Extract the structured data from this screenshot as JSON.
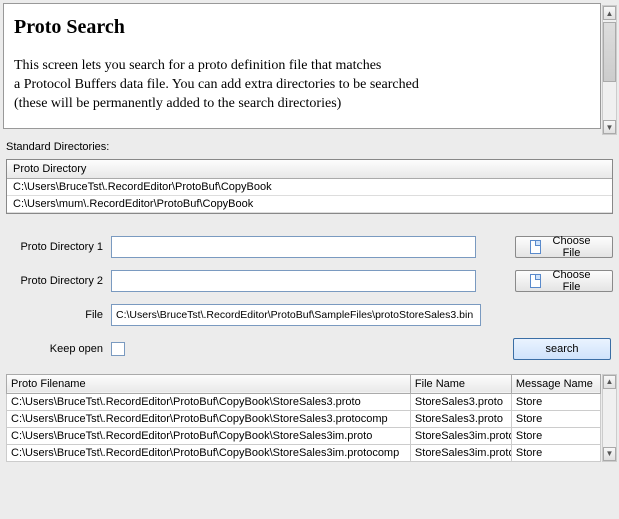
{
  "header": {
    "title": "Proto Search",
    "desc_line1": "This screen lets you search for a proto definition file that matches",
    "desc_line2": "a Protocol Buffers data file. You can add extra directories to be searched",
    "desc_line3": "(these will be permanently added to the search directories)"
  },
  "std_dirs": {
    "label": "Standard Directories:",
    "header": "Proto Directory",
    "rows": [
      "C:\\Users\\BruceTst\\.RecordEditor\\ProtoBuf\\CopyBook",
      "C:\\Users\\mum\\.RecordEditor\\ProtoBuf\\CopyBook"
    ]
  },
  "form": {
    "dir1_label": "Proto Directory 1",
    "dir1_value": "",
    "dir2_label": "Proto Directory 2",
    "dir2_value": "",
    "file_label": "File",
    "file_value": "C:\\Users\\BruceTst\\.RecordEditor\\ProtoBuf\\SampleFiles\\protoStoreSales3.bin",
    "choose_label": "Choose File",
    "keep_label": "Keep open",
    "search_label": "search"
  },
  "results": {
    "col1": "Proto Filename",
    "col2": "File Name",
    "col3": "Message Name",
    "rows": [
      {
        "filename": "C:\\Users\\BruceTst\\.RecordEditor\\ProtoBuf\\CopyBook\\StoreSales3.proto",
        "file": "StoreSales3.proto",
        "msg": "Store"
      },
      {
        "filename": "C:\\Users\\BruceTst\\.RecordEditor\\ProtoBuf\\CopyBook\\StoreSales3.protocomp",
        "file": "StoreSales3.proto",
        "msg": "Store"
      },
      {
        "filename": "C:\\Users\\BruceTst\\.RecordEditor\\ProtoBuf\\CopyBook\\StoreSales3im.proto",
        "file": "StoreSales3im.proto",
        "msg": "Store"
      },
      {
        "filename": "C:\\Users\\BruceTst\\.RecordEditor\\ProtoBuf\\CopyBook\\StoreSales3im.protocomp",
        "file": "StoreSales3im.proto",
        "msg": "Store"
      }
    ]
  }
}
